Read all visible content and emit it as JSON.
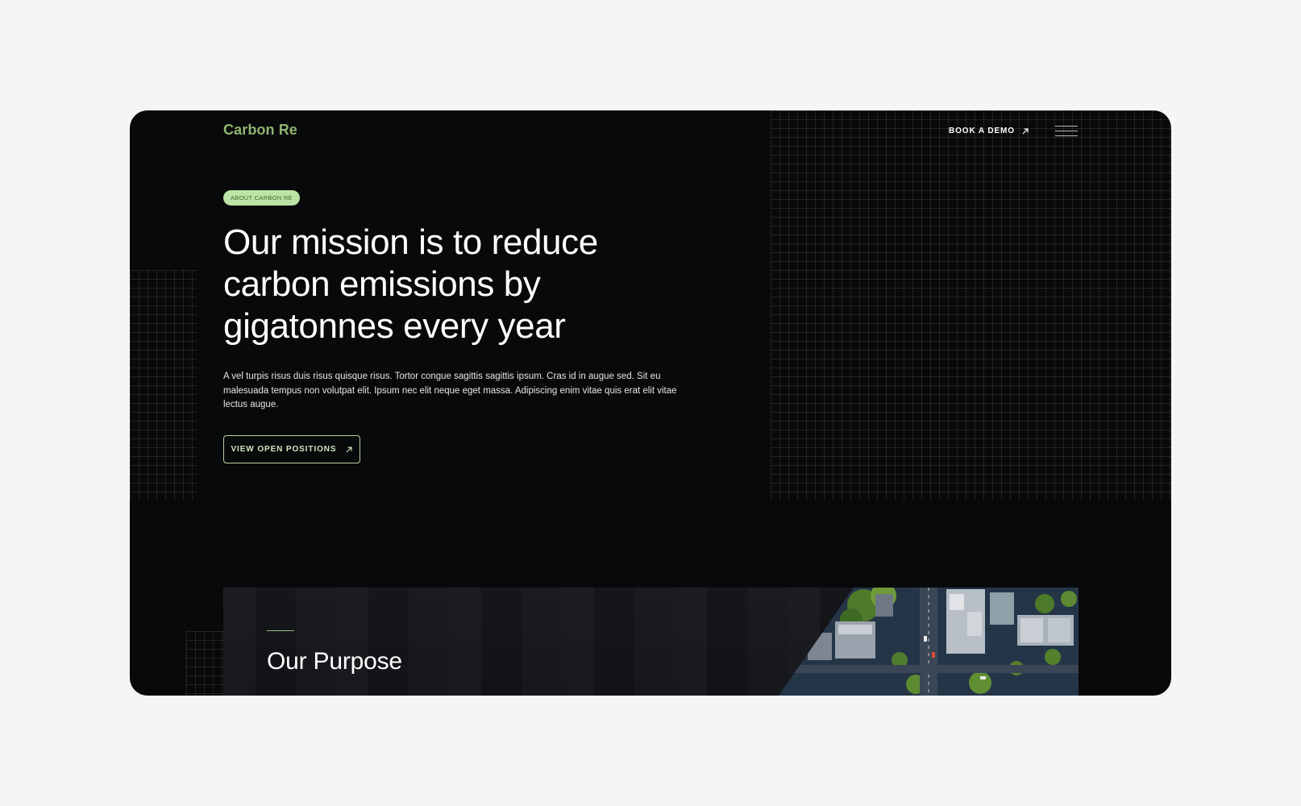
{
  "brand": {
    "name": "Carbon Re",
    "accent_color": "#8fb56f",
    "badge_color": "#bde4a6"
  },
  "nav": {
    "demo_label": "BOOK A DEMO",
    "demo_icon": "arrow-up-right-icon",
    "menu_icon": "hamburger-menu-icon"
  },
  "hero": {
    "badge": "ABOUT CARBON RE",
    "headline": "Our mission is to reduce carbon emissions by gigatonnes every year",
    "body": "A vel turpis risus duis risus quisque risus. Tortor congue sagittis sagittis ipsum. Cras id in augue sed. Sit eu malesuada tempus non volutpat elit. Ipsum nec elit neque eget massa. Adipiscing enim vitae quis erat elit vitae lectus augue.",
    "cta_label": "VIEW OPEN POSITIONS",
    "cta_icon": "arrow-up-right-icon"
  },
  "purpose": {
    "title": "Our Purpose",
    "image": "aerial-city-photo"
  }
}
